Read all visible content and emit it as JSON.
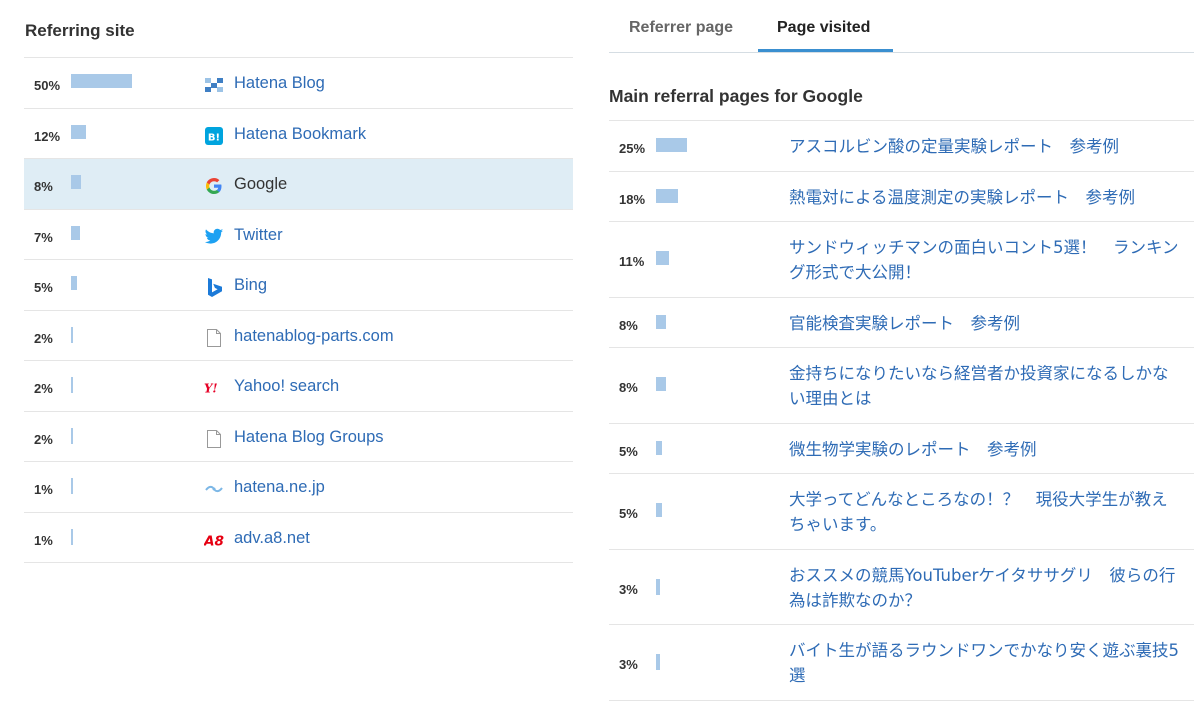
{
  "left": {
    "title": "Referring site",
    "rows": [
      {
        "pct": "50%",
        "value": 50,
        "label": "Hatena Blog",
        "icon": "hatena-blog-icon"
      },
      {
        "pct": "12%",
        "value": 12,
        "label": "Hatena Bookmark",
        "icon": "hatena-bookmark-icon"
      },
      {
        "pct": "8%",
        "value": 8,
        "label": "Google",
        "icon": "google-icon"
      },
      {
        "pct": "7%",
        "value": 7,
        "label": "Twitter",
        "icon": "twitter-icon"
      },
      {
        "pct": "5%",
        "value": 5,
        "label": "Bing",
        "icon": "bing-icon"
      },
      {
        "pct": "2%",
        "value": 2,
        "label": "hatenablog-parts.com",
        "icon": "document-icon"
      },
      {
        "pct": "2%",
        "value": 2,
        "label": "Yahoo! search",
        "icon": "yahoo-icon"
      },
      {
        "pct": "2%",
        "value": 2,
        "label": "Hatena Blog Groups",
        "icon": "document-icon"
      },
      {
        "pct": "1%",
        "value": 1,
        "label": "hatena.ne.jp",
        "icon": "hatena-icon"
      },
      {
        "pct": "1%",
        "value": 1,
        "label": "adv.a8.net",
        "icon": "a8-icon"
      }
    ]
  },
  "right": {
    "tabs": [
      {
        "label": "Referrer page",
        "active": false
      },
      {
        "label": "Page visited",
        "active": true
      }
    ],
    "title": "Main referral pages for Google",
    "rows": [
      {
        "pct": "25%",
        "value": 25,
        "label": "アスコルビン酸の定量実験レポート　参考例"
      },
      {
        "pct": "18%",
        "value": 18,
        "label": "熱電対による温度測定の実験レポート　参考例"
      },
      {
        "pct": "11%",
        "value": 11,
        "label": "サンドウィッチマンの面白いコント5選！　ランキング形式で大公開！"
      },
      {
        "pct": "8%",
        "value": 8,
        "label": "官能検査実験レポート　参考例"
      },
      {
        "pct": "8%",
        "value": 8,
        "label": "金持ちになりたいなら経営者か投資家になるしかない理由とは"
      },
      {
        "pct": "5%",
        "value": 5,
        "label": "微生物学実験のレポート　参考例"
      },
      {
        "pct": "5%",
        "value": 5,
        "label": "大学ってどんなところなの！？　現役大学生が教えちゃいます。"
      },
      {
        "pct": "3%",
        "value": 3,
        "label": "おススメの競馬YouTuberケイタササグリ　彼らの行為は詐欺なのか？"
      },
      {
        "pct": "3%",
        "value": 3,
        "label": "バイト生が語るラウンドワンでかなり安く遊ぶ裏技5選"
      }
    ]
  }
}
